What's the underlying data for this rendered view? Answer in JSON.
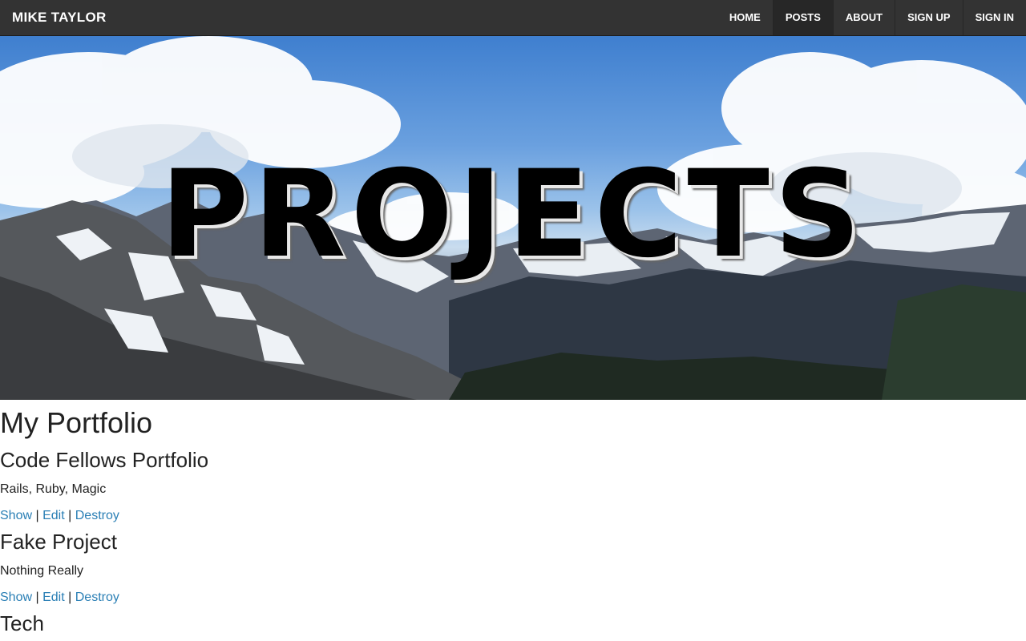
{
  "header": {
    "brand": "MIKE TAYLOR",
    "nav": [
      {
        "label": "HOME",
        "active": false
      },
      {
        "label": "POSTS",
        "active": true
      },
      {
        "label": "ABOUT",
        "active": false
      },
      {
        "label": "SIGN UP",
        "active": false
      },
      {
        "label": "SIGN IN",
        "active": false
      }
    ]
  },
  "hero": {
    "title": "PROJECTS",
    "image": "mountain-panorama-image"
  },
  "main": {
    "title": "My Portfolio",
    "projects": [
      {
        "name": "Code Fellows Portfolio",
        "description": "Rails, Ruby, Magic",
        "show": "Show",
        "edit": "Edit",
        "destroy": "Destroy"
      },
      {
        "name": "Fake Project",
        "description": "Nothing Really",
        "show": "Show",
        "edit": "Edit",
        "destroy": "Destroy"
      },
      {
        "name": "Tech"
      }
    ],
    "separator": "|"
  },
  "colors": {
    "topbar": "#333333",
    "link": "#2a7fb5",
    "text": "#222222"
  }
}
